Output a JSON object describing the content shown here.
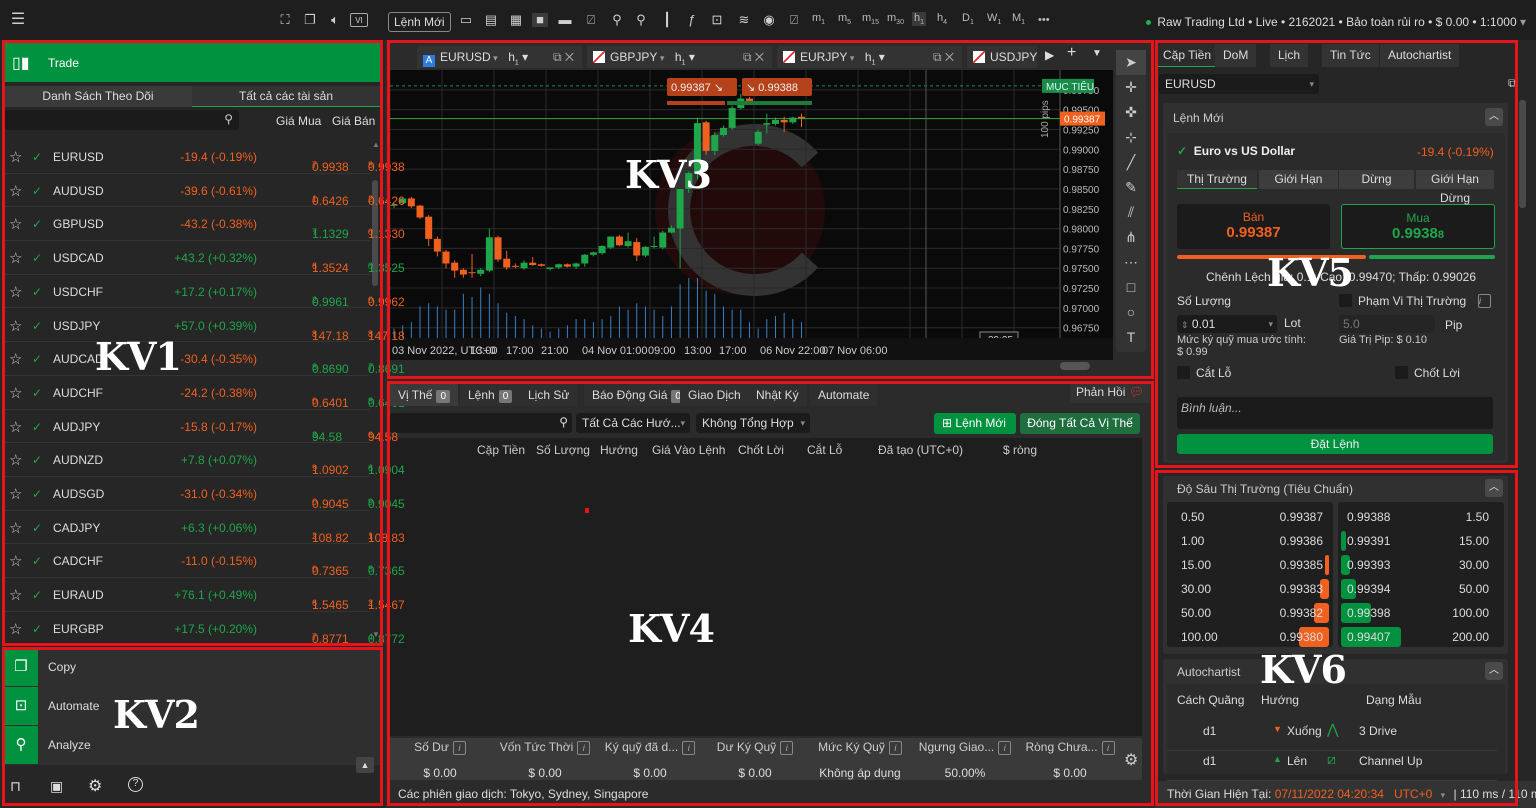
{
  "annotations": {
    "kv1": "KV1",
    "kv2": "KV2",
    "kv3": "KV3",
    "kv4": "KV4",
    "kv5": "KV5",
    "kv6": "KV6",
    "box_color": "#e8141c"
  },
  "colors": {
    "green": "#00923f",
    "up": "#1fa64a",
    "down": "#f0601f"
  },
  "toolbar": {
    "new_order": "Lệnh Mới",
    "timeframes": [
      [
        "m",
        "1"
      ],
      [
        "m",
        "5"
      ],
      [
        "m",
        "15"
      ],
      [
        "m",
        "30"
      ],
      [
        "h",
        "1"
      ],
      [
        "h",
        "4"
      ],
      [
        "D",
        "1"
      ],
      [
        "W",
        "1"
      ],
      [
        "M",
        "1"
      ]
    ],
    "more": "•••",
    "account": "Raw Trading Ltd • Live • 2162021 • Bảo toàn rủi ro • $ 0.00 • 1:1000"
  },
  "left": {
    "trade": "Trade",
    "tabs": [
      "Danh Sách Theo Dõi",
      "Tất cả các tài sản"
    ],
    "col_bid": "Giá Mua",
    "col_ask": "Giá Bán",
    "watchlist": [
      {
        "sym": "EURUSD",
        "chg": "-19.4 (-0.19%)",
        "dir": "down",
        "bid": "0.9938",
        "bid_s": "7",
        "bid_dir": "down",
        "ask": "0.9938",
        "ask_s": "8",
        "ask_dir": "down"
      },
      {
        "sym": "AUDUSD",
        "chg": "-39.6 (-0.61%)",
        "dir": "down",
        "bid": "0.6426",
        "bid_s": "1",
        "bid_dir": "down",
        "ask": "0.6426",
        "ask_s": "2",
        "ask_dir": "down"
      },
      {
        "sym": "GBPUSD",
        "chg": "-43.2 (-0.38%)",
        "dir": "down",
        "bid": "1.1329",
        "bid_s": "7",
        "bid_dir": "up",
        "ask": "1.1330",
        "ask_s": "0",
        "ask_dir": "down"
      },
      {
        "sym": "USDCAD",
        "chg": "+43.2 (+0.32%)",
        "dir": "up",
        "bid": "1.3524",
        "bid_s": "6",
        "bid_dir": "down",
        "ask": "1.3525",
        "ask_s": "0",
        "ask_dir": "up"
      },
      {
        "sym": "USDCHF",
        "chg": "+17.2 (+0.17%)",
        "dir": "up",
        "bid": "0.9961",
        "bid_s": "2",
        "bid_dir": "up",
        "ask": "0.9962",
        "ask_s": "0",
        "ask_dir": "down"
      },
      {
        "sym": "USDJPY",
        "chg": "+57.0 (+0.39%)",
        "dir": "up",
        "bid": "147.18",
        "bid_s": "8",
        "bid_dir": "down",
        "ask": "147.18",
        "ask_s": "8",
        "ask_dir": "down"
      },
      {
        "sym": "AUDCAD",
        "chg": "-30.4 (-0.35%)",
        "dir": "down",
        "bid": "0.8690",
        "bid_s": "8",
        "bid_dir": "up",
        "ask": "0.8691",
        "ask_s": "7",
        "ask_dir": "up"
      },
      {
        "sym": "AUDCHF",
        "chg": "-24.2 (-0.38%)",
        "dir": "down",
        "bid": "0.6401",
        "bid_s": "0",
        "bid_dir": "down",
        "ask": "0.6401",
        "ask_s": "8",
        "ask_dir": "up"
      },
      {
        "sym": "AUDJPY",
        "chg": "-15.8 (-0.17%)",
        "dir": "down",
        "bid": "94.58",
        "bid_s": "3",
        "bid_dir": "up",
        "ask": "94.58",
        "ask_s": "6",
        "ask_dir": "down"
      },
      {
        "sym": "AUDNZD",
        "chg": "+7.8 (+0.07%)",
        "dir": "up",
        "bid": "1.0902",
        "bid_s": "9",
        "bid_dir": "down",
        "ask": "1.0904",
        "ask_s": "6",
        "ask_dir": "up"
      },
      {
        "sym": "AUDSGD",
        "chg": "-31.0 (-0.34%)",
        "dir": "down",
        "bid": "0.9045",
        "bid_s": "0",
        "bid_dir": "down",
        "ask": "0.9045",
        "ask_s": "9",
        "ask_dir": "up"
      },
      {
        "sym": "CADJPY",
        "chg": "+6.3 (+0.06%)",
        "dir": "up",
        "bid": "108.82",
        "bid_s": "2",
        "bid_dir": "down",
        "ask": "108.83",
        "ask_s": "1",
        "ask_dir": "down"
      },
      {
        "sym": "CADCHF",
        "chg": "-11.0 (-0.15%)",
        "dir": "down",
        "bid": "0.7365",
        "bid_s": "0",
        "bid_dir": "down",
        "ask": "0.7365",
        "ask_s": "8",
        "ask_dir": "up"
      },
      {
        "sym": "EURAUD",
        "chg": "+76.1 (+0.49%)",
        "dir": "up",
        "bid": "1.5465",
        "bid_s": "6",
        "bid_dir": "down",
        "ask": "1.5467",
        "ask_s": "2",
        "ask_dir": "down"
      },
      {
        "sym": "EURGBP",
        "chg": "+17.5 (+0.20%)",
        "dir": "up",
        "bid": "0.8771",
        "bid_s": "7",
        "bid_dir": "down",
        "ask": "0.8772",
        "ask_s": "4",
        "ask_dir": "up"
      }
    ],
    "apps": [
      "Copy",
      "Automate",
      "Analyze"
    ]
  },
  "chart": {
    "tabs": [
      "EURUSD",
      "GBPJPY",
      "EURJPY",
      "USDJPY"
    ],
    "tab_tf": "h",
    "tab_tf_sub": "1",
    "sell_btn": "0.9938",
    "sell_btn_s": "7",
    "buy_btn": "0.9938",
    "buy_btn_s": "8",
    "target_label": "MỤC TIÊU",
    "pips_label": "100 pips",
    "current_price": "0.99387",
    "countdown": "39:25",
    "y_ticks": [
      "0.9975",
      "0.9950",
      "0.9925",
      "0.9900",
      "0.9875",
      "0.9850",
      "0.9825",
      "0.9800",
      "0.9775",
      "0.9750",
      "0.9725",
      "0.9700",
      "0.9675"
    ],
    "y_tick_suffix": "0",
    "x_ticks": [
      "03 Nov 2022, UTC+0",
      "13:00",
      "17:00",
      "21:00",
      "04 Nov 01:00",
      "09:00",
      "13:00",
      "17:00",
      "06 Nov 22:00",
      "07 Nov 06:00"
    ]
  },
  "chart_data": {
    "type": "candlestick",
    "ylim": [
      0.9662,
      1.0
    ],
    "target": 0.998,
    "current": 0.99387,
    "candles": [
      [
        0.9829,
        0.9832,
        0.9826,
        0.983
      ],
      [
        0.9832,
        0.9839,
        0.983,
        0.9838
      ],
      [
        0.9838,
        0.984,
        0.9826,
        0.9828
      ],
      [
        0.9829,
        0.983,
        0.9812,
        0.9814
      ],
      [
        0.9815,
        0.9817,
        0.9778,
        0.9787
      ],
      [
        0.9787,
        0.979,
        0.9765,
        0.9771
      ],
      [
        0.9771,
        0.9773,
        0.975,
        0.9756
      ],
      [
        0.9757,
        0.976,
        0.9738,
        0.9747
      ],
      [
        0.9748,
        0.975,
        0.9738,
        0.9742
      ],
      [
        0.9745,
        0.9768,
        0.9738,
        0.9744
      ],
      [
        0.9743,
        0.975,
        0.974,
        0.9748
      ],
      [
        0.9747,
        0.98,
        0.9745,
        0.9789
      ],
      [
        0.9789,
        0.9791,
        0.9758,
        0.9761
      ],
      [
        0.9762,
        0.9772,
        0.9748,
        0.9751
      ],
      [
        0.9753,
        0.9756,
        0.975,
        0.9752
      ],
      [
        0.975,
        0.976,
        0.9748,
        0.9757
      ],
      [
        0.9757,
        0.9764,
        0.9753,
        0.9754
      ],
      [
        0.9755,
        0.9756,
        0.9752,
        0.9753
      ],
      [
        0.9749,
        0.9751,
        0.9747,
        0.9751
      ],
      [
        0.9751,
        0.9756,
        0.9749,
        0.9755
      ],
      [
        0.9755,
        0.9756,
        0.9751,
        0.9752
      ],
      [
        0.9752,
        0.9757,
        0.9749,
        0.9756
      ],
      [
        0.9756,
        0.9768,
        0.9752,
        0.9767
      ],
      [
        0.9767,
        0.9771,
        0.9765,
        0.977
      ],
      [
        0.9769,
        0.9779,
        0.9767,
        0.9778
      ],
      [
        0.9776,
        0.979,
        0.9774,
        0.979
      ],
      [
        0.979,
        0.9792,
        0.9778,
        0.9779
      ],
      [
        0.9778,
        0.9795,
        0.9776,
        0.9784
      ],
      [
        0.9783,
        0.9788,
        0.9759,
        0.9766
      ],
      [
        0.9766,
        0.9778,
        0.9764,
        0.9777
      ],
      [
        0.9777,
        0.979,
        0.9775,
        0.9778
      ],
      [
        0.9776,
        0.9797,
        0.9774,
        0.9795
      ],
      [
        0.9795,
        0.9804,
        0.9794,
        0.9801
      ],
      [
        0.98,
        0.981,
        0.975,
        0.985
      ],
      [
        0.985,
        0.9872,
        0.9845,
        0.987
      ],
      [
        0.987,
        0.994,
        0.9862,
        0.9933
      ],
      [
        0.9934,
        0.9936,
        0.9893,
        0.9898
      ],
      [
        0.9898,
        0.9922,
        0.9893,
        0.9918
      ],
      [
        0.9918,
        0.993,
        0.9916,
        0.9927
      ],
      [
        0.9927,
        0.9955,
        0.9924,
        0.9952
      ],
      [
        0.9952,
        0.997,
        0.995,
        0.9964
      ],
      [
        0.9964,
        0.9966,
        0.996,
        0.9961
      ],
      [
        0.9907,
        0.9925,
        0.9905,
        0.9922
      ],
      [
        0.9931,
        0.9945,
        0.992,
        0.9933
      ],
      [
        0.9932,
        0.994,
        0.993,
        0.9937
      ],
      [
        0.9937,
        0.9941,
        0.9922,
        0.9934
      ],
      [
        0.9934,
        0.9941,
        0.9932,
        0.994
      ],
      [
        0.9941,
        0.9945,
        0.9928,
        0.9939
      ]
    ],
    "volume": [
      3,
      4,
      5,
      10,
      11,
      10,
      9,
      9,
      14,
      13,
      16,
      14,
      11,
      8,
      7,
      6,
      4,
      3,
      2,
      3,
      4,
      6,
      6,
      5,
      6,
      7,
      10,
      9,
      11,
      10,
      9,
      7,
      10,
      17,
      19,
      19,
      15,
      14,
      10,
      9,
      9,
      5,
      3,
      6,
      7,
      8,
      6,
      5
    ]
  },
  "positions": {
    "tabs": [
      {
        "label": "Vị Thế",
        "badge": "0"
      },
      {
        "label": "Lệnh",
        "badge": "0"
      },
      {
        "label": "Lịch Sử"
      },
      {
        "label": "Báo Động Giá",
        "badge": "0"
      },
      {
        "label": "Giao Dịch"
      },
      {
        "label": "Nhật Ký"
      },
      {
        "label": "Automate"
      }
    ],
    "feedback": "Phản Hồi",
    "filter_dir": "Tất Cả Các Hướ...",
    "filter_group": "Không Tổng Hợp",
    "new_order": "Lệnh Mới",
    "close_all": "Đóng Tất Cả Vị Thế",
    "columns": [
      "Cặp Tiền",
      "Số Lượng",
      "Hướng",
      "Giá Vào Lệnh",
      "Chốt Lời",
      "Cắt Lỗ",
      "Đã tạo (UTC+0)",
      "$ ròng"
    ],
    "stats": [
      {
        "label": "Số Dư",
        "value": "$ 0.00"
      },
      {
        "label": "Vốn Tức Thời",
        "value": "$ 0.00"
      },
      {
        "label": "Ký quỹ đã d...",
        "value": "$ 0.00"
      },
      {
        "label": "Dư Ký Quỹ",
        "value": "$ 0.00"
      },
      {
        "label": "Mức Ký Quỹ",
        "value": "Không áp dụng"
      },
      {
        "label": "Ngưng Giao...",
        "value": "50.00%"
      },
      {
        "label": "Ròng Chưa...",
        "value": "$ 0.00"
      }
    ],
    "sessions": "Các phiên giao dịch: Tokyo, Sydney, Singapore"
  },
  "right": {
    "tabs": [
      "Cặp Tiền",
      "DoM",
      "Lịch",
      "Tin Tức",
      "Autochartist"
    ],
    "symbol": "EURUSD",
    "order": {
      "title": "Lệnh Mới",
      "name": "Euro vs US Dollar",
      "chg": "-19.4 (-0.19%)",
      "types": [
        "Thị Trường",
        "Giới Hạn",
        "Dừng",
        "Giới Hạn Dừng"
      ],
      "sell_label": "Bán",
      "sell": "0.9938",
      "sell_s": "7",
      "buy_label": "Mua",
      "buy": "0.9938",
      "buy_s": "8",
      "spread": "Chênh Lệch giá: 0.1; Cao: 0.99470; Thấp: 0.99026",
      "qty_label": "Số Lượng",
      "qty": "0.01",
      "lot": "Lot",
      "margin": "Mức ký quỹ mua ước tính:",
      "margin_val": "$ 0.99",
      "range_label": "Phạm Vi Thị Trường",
      "range_val": "5.0",
      "pip": "Pip",
      "pip_value": "Giá Trị Pip: $ 0.10",
      "stop_loss": "Cắt Lỗ",
      "take_profit": "Chốt Lời",
      "comment_ph": "Bình luận...",
      "place": "Đặt Lệnh"
    },
    "dom": {
      "title": "Độ Sâu Thị Trường (Tiêu Chuẩn)",
      "bids": [
        [
          "0.50",
          "0.99387",
          0
        ],
        [
          "1.00",
          "0.99386",
          0
        ],
        [
          "15.00",
          "0.99385",
          15
        ],
        [
          "30.00",
          "0.99383",
          30
        ],
        [
          "50.00",
          "0.99382",
          50
        ],
        [
          "100.00",
          "0.99380",
          100
        ]
      ],
      "asks": [
        [
          "0.99388",
          "1.50",
          0
        ],
        [
          "0.99391",
          "15.00",
          15
        ],
        [
          "0.99393",
          "30.00",
          30
        ],
        [
          "0.99394",
          "50.00",
          50
        ],
        [
          "0.99398",
          "100.00",
          100
        ],
        [
          "0.99407",
          "200.00",
          200
        ]
      ]
    },
    "autochartist": {
      "title": "Autochartist",
      "cols": [
        "Cách Quãng",
        "Hướng",
        "Dạng Mẫu"
      ],
      "rows": [
        {
          "interval": "d1",
          "dir": "Xuống",
          "trend": "down",
          "pattern": "3 Drive"
        },
        {
          "interval": "d1",
          "dir": "Lên",
          "trend": "up",
          "pattern": "Channel Up"
        }
      ]
    },
    "status": {
      "label": "Thời Gian Hiện Tại:",
      "time": "07/11/2022 04:20:34",
      "tz": "UTC+0",
      "latency": "| 110 ms / 110 ms"
    }
  }
}
